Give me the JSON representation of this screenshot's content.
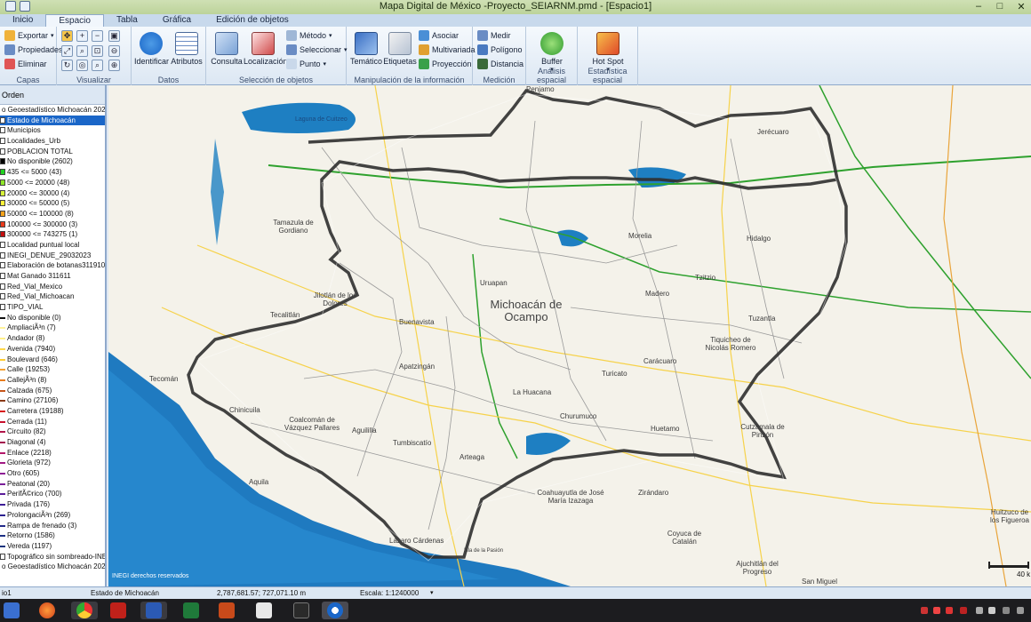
{
  "window": {
    "title": "Mapa Digital de México -Proyecto_SEIARNM.pmd - [Espacio1]"
  },
  "tabs": [
    "Inicio",
    "Espacio",
    "Tabla",
    "Gráfica",
    "Edición de objetos"
  ],
  "active_tab": "Espacio",
  "ribbon": {
    "capas": {
      "title": "Capas",
      "exportar": "Exportar",
      "propiedades": "Propiedades",
      "eliminar": "Eliminar"
    },
    "visualizar": {
      "title": "Visualizar"
    },
    "datos": {
      "title": "Datos",
      "identificar": "Identificar",
      "atributos": "Atributos"
    },
    "seleccion": {
      "title": "Selección de objetos",
      "consulta": "Consulta",
      "localizacion": "Localización",
      "metodo": "Método",
      "seleccionar": "Seleccionar",
      "punto": "Punto"
    },
    "manipulacion": {
      "title": "Manipulación de la información",
      "tematico": "Temático",
      "etiquetas": "Etiquetas",
      "asociar": "Asociar",
      "multivariada": "Multivariada",
      "proyeccion": "Proyección"
    },
    "medicion": {
      "title": "Medición",
      "medir": "Medir",
      "poligono": "Polígono",
      "distancia": "Distancia"
    },
    "analisis": {
      "title": "Análisis espacial",
      "buffer": "Buffer"
    },
    "estadistica": {
      "title": "Estadística espacial",
      "hotspot": "Hot Spot"
    }
  },
  "layers": {
    "header": "Orden",
    "items": [
      {
        "label": "o Geoestadístico Michoacán 2021",
        "kind": "header"
      },
      {
        "label": "Estado de Michoacán",
        "kind": "selected"
      },
      {
        "label": "Municipios",
        "kind": "plain"
      },
      {
        "label": "Localidades_Urb",
        "kind": "plain"
      },
      {
        "label": "POBLACION TOTAL",
        "kind": "group"
      },
      {
        "label": "No disponible (2602)",
        "swatch": "#000000"
      },
      {
        "label": "435 <= 5000 (43)",
        "swatch": "#22d322"
      },
      {
        "label": "5000 <= 20000 (48)",
        "swatch": "#8fe62a"
      },
      {
        "label": "20000 <= 30000 (4)",
        "swatch": "#d7f23a"
      },
      {
        "label": "30000 <= 50000 (5)",
        "swatch": "#fff23a"
      },
      {
        "label": "50000 <= 100000 (8)",
        "swatch": "#f6a21a"
      },
      {
        "label": "100000 <= 300000 (3)",
        "swatch": "#ea3a1a"
      },
      {
        "label": "300000 <= 743275 (1)",
        "swatch": "#c40d0d"
      },
      {
        "label": "Localidad puntual local",
        "kind": "plain"
      },
      {
        "label": "INEGI_DENUE_29032023",
        "kind": "plain"
      },
      {
        "label": "Elaboración de botanas311910",
        "kind": "plain"
      },
      {
        "label": "Mat Ganado 311611",
        "kind": "plain"
      },
      {
        "label": "Red_Vial_Mexico",
        "kind": "plain"
      },
      {
        "label": "Red_Vial_Michoacan",
        "kind": "plain"
      },
      {
        "label": "TIPO_VIAL",
        "kind": "group"
      },
      {
        "label": "No disponible (0)",
        "line": "#111111"
      },
      {
        "label": "AmpliaciÃ³n (7)",
        "line": "#fff39c"
      },
      {
        "label": "Andador (8)",
        "line": "#fff08a"
      },
      {
        "label": "Avenida (7940)",
        "line": "#ffd84a"
      },
      {
        "label": "Boulevard (646)",
        "line": "#ffcc33"
      },
      {
        "label": "Calle (19253)",
        "line": "#f6a233"
      },
      {
        "label": "CallejÃ³n (8)",
        "line": "#e87d1d"
      },
      {
        "label": "Calzada (675)",
        "line": "#c6551a"
      },
      {
        "label": "Camino (27106)",
        "line": "#8a3a17"
      },
      {
        "label": "Carretera (19188)",
        "line": "#d81b1b"
      },
      {
        "label": "Cerrada (11)",
        "line": "#c8102e"
      },
      {
        "label": "Circuito (82)",
        "line": "#b0154a"
      },
      {
        "label": "Diagonal (4)",
        "line": "#a4124e"
      },
      {
        "label": "Enlace (2218)",
        "line": "#b4186a"
      },
      {
        "label": "Glorieta (972)",
        "line": "#a11a84"
      },
      {
        "label": "Otro (605)",
        "line": "#8e1e95"
      },
      {
        "label": "Peatonal (20)",
        "line": "#7a1f99"
      },
      {
        "label": "PerifÃ©rico (700)",
        "line": "#5b1d9a"
      },
      {
        "label": "Privada (176)",
        "line": "#3d1d97"
      },
      {
        "label": "ProlongaciÃ³n (269)",
        "line": "#2b1f8f"
      },
      {
        "label": "Rampa de frenado (3)",
        "line": "#232a8a"
      },
      {
        "label": "Retorno (1586)",
        "line": "#1c2f84"
      },
      {
        "label": "Vereda (1197)",
        "line": "#17347d"
      },
      {
        "label": "Topográfico sin sombreado-INE",
        "kind": "plain"
      },
      {
        "label": "o Geoestadístico Michoacán 2022",
        "kind": "header"
      }
    ]
  },
  "map": {
    "state_label": "Michoacán de Ocampo",
    "copyright": "INEGI derechos reservados",
    "scale_bar": "40 k",
    "labels": [
      "Penjamo",
      "Laguna de Cuitzeo",
      "Jerécuaro",
      "Tamazula de Gordiano",
      "Morelia",
      "Hidalgo",
      "Uruapan",
      "Madero",
      "Tzitzio",
      "Jilotlán de los Dolores",
      "Tecalitlán",
      "Buenavista",
      "Tuzantla",
      "Tiquicheo de Nicolás Romero",
      "Carácuaro",
      "Tecomán",
      "Apatzingán",
      "Turicato",
      "La Huacana",
      "Chinicuila",
      "Coalcomán de Vázquez Pallares",
      "Aguililla",
      "Churumuco",
      "Huetamo",
      "Cutzamala de Pinzón",
      "Tumbiscatío",
      "Arteaga",
      "Coahuayutla de José María Izazaga",
      "Zirándaro",
      "Aquila",
      "Lázaro Cárdenas",
      "Coyuca de Catalán",
      "Ajuchitlán del Progreso",
      "San Miguel",
      "Huitzuco de los Figueroa",
      "Isla de la Pasión"
    ]
  },
  "status": {
    "tab": "io1",
    "layer": "Estado de Michoacán",
    "coords": "2,787,681.57; 727,071.10 m",
    "scale": "Escala: 1:1240000"
  },
  "colors": {
    "ribbon_accent": "#1a66c8",
    "state_border": "#3a3a3a",
    "water": "#1e7fc2",
    "roads_green": "#2ea12e",
    "roads_yellow": "#f6d24a"
  }
}
